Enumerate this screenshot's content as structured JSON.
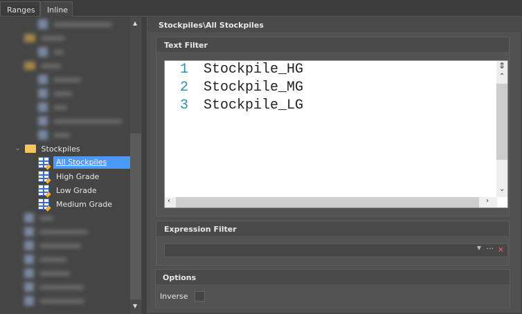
{
  "tabs": [
    {
      "label": "Ranges"
    },
    {
      "label": "Inline"
    }
  ],
  "tree": {
    "folder": "Stockpiles",
    "items": [
      {
        "label": "All Stockpiles",
        "selected": true
      },
      {
        "label": "High Grade"
      },
      {
        "label": "Low Grade"
      },
      {
        "label": "Medium Grade"
      }
    ]
  },
  "header": {
    "title": "Stockpiles\\All Stockpiles"
  },
  "text_filter": {
    "title": "Text Filter",
    "lines": [
      {
        "n": "1",
        "text": "Stockpile_HG"
      },
      {
        "n": "2",
        "text": "Stockpile_MG"
      },
      {
        "n": "3",
        "text": "Stockpile_LG"
      }
    ]
  },
  "expression_filter": {
    "title": "Expression Filter",
    "value": ""
  },
  "options": {
    "title": "Options",
    "inverse_label": "Inverse",
    "inverse_checked": false
  }
}
